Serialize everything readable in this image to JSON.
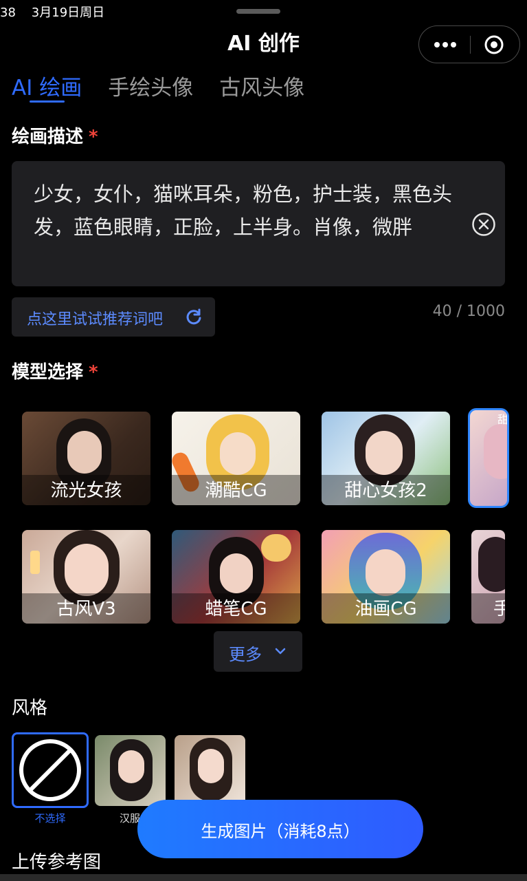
{
  "status_bar": {
    "time": "38",
    "date": "3月19日周日"
  },
  "header": {
    "title": "AI 创作"
  },
  "tabs": [
    {
      "label": "AI 绘画",
      "active": true
    },
    {
      "label": "手绘头像",
      "active": false
    },
    {
      "label": "古风头像",
      "active": false
    }
  ],
  "description": {
    "label": "绘画描述",
    "required_mark": "*",
    "text": "少女，女仆，猫咪耳朵，粉色，护士装，黑色头发，蓝色眼睛，正脸，上半身。肖像，微胖",
    "counter": "40 / 1000",
    "suggest_label": "点这里试试推荐词吧"
  },
  "models": {
    "label": "模型选择",
    "required_mark": "*",
    "row1": [
      {
        "name": "流光女孩"
      },
      {
        "name": "潮酷CG"
      },
      {
        "name": "甜心女孩2"
      },
      {
        "name": "甜",
        "selected": true
      }
    ],
    "row2": [
      {
        "name": "古风V3"
      },
      {
        "name": "蜡笔CG"
      },
      {
        "name": "油画CG"
      },
      {
        "name": "手"
      }
    ],
    "more_label": "更多"
  },
  "style": {
    "label": "风格",
    "options": [
      {
        "name": "不选择",
        "selected": true
      },
      {
        "name": "汉服",
        "selected": false
      },
      {
        "name": "",
        "selected": false
      }
    ]
  },
  "upload": {
    "label": "上传参考图"
  },
  "generate_button": {
    "label": "生成图片（消耗8点）"
  },
  "colors": {
    "accent": "#2f6bff",
    "required": "#f0443a",
    "panel": "#1f1f22"
  }
}
